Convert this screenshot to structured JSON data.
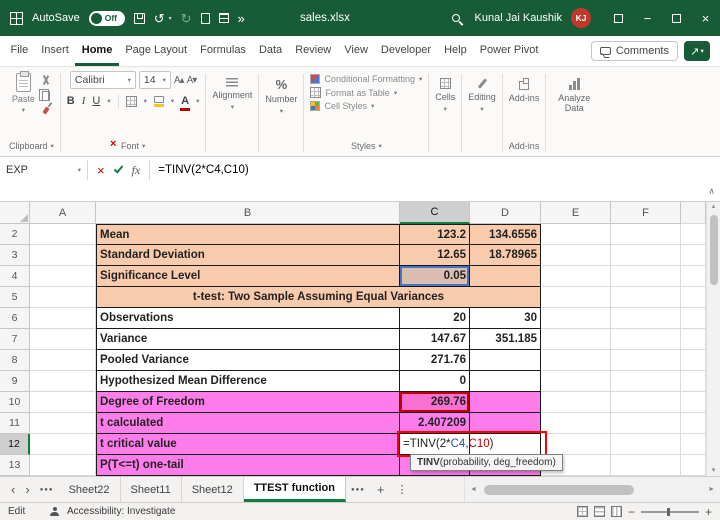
{
  "colors": {
    "titlebar_green": "#185C37",
    "accent_green": "#107C41",
    "orange_fill": "#F8CBAD",
    "pink_fill": "#FF7DEB",
    "ref_blue": "#2B4BC8",
    "ref_red": "#C00000",
    "annotation_red": "#FF0000",
    "avatar_red": "#C0392B"
  },
  "title_bar": {
    "autosave_label": "AutoSave",
    "autosave_state": "Off",
    "filename": "sales.xlsx",
    "user_name": "Kunal Jai Kaushik",
    "user_initials": "KJ"
  },
  "menu": {
    "tabs": [
      "File",
      "Insert",
      "Home",
      "Page Layout",
      "Formulas",
      "Data",
      "Review",
      "View",
      "Developer",
      "Help",
      "Power Pivot"
    ],
    "active_tab": "Home",
    "comments_label": "Comments"
  },
  "ribbon": {
    "paste_label": "Paste",
    "font_name": "Calibri",
    "font_size": "14",
    "bold": "B",
    "italic": "I",
    "underline": "U",
    "groups": {
      "clipboard": "Clipboard",
      "font": "Font",
      "alignment": "Alignment",
      "number": "Number",
      "styles": "Styles",
      "cells": "Cells",
      "editing": "Editing",
      "addins": "Add-ins",
      "analyze": "Analyze Data"
    },
    "styles_items": [
      "Conditional Formatting",
      "Format as Table",
      "Cell Styles"
    ]
  },
  "formula_bar": {
    "name_box": "EXP",
    "fx": "fx",
    "formula": {
      "prefix": "=TINV(2*",
      "ref1": "C4",
      "sep": ",",
      "ref2": "C10",
      "suffix": ")"
    }
  },
  "grid": {
    "columns": [
      "A",
      "B",
      "C",
      "D",
      "E",
      "F"
    ],
    "selected_column": "C",
    "selected_row": "12",
    "rows": [
      {
        "num": "2",
        "label": "Mean",
        "c": "123.2",
        "d": "134.6556",
        "bg": "orange"
      },
      {
        "num": "3",
        "label": "Standard Deviation",
        "c": "12.65",
        "d": "18.78965",
        "bg": "orange"
      },
      {
        "num": "4",
        "label": "Significance Level",
        "c": "0.05",
        "d": "",
        "bg": "orange",
        "ref": "blue"
      },
      {
        "num": "5",
        "merged": "t-test: Two Sample Assuming Equal Variances",
        "bg": "orange"
      },
      {
        "num": "6",
        "label": "Observations",
        "c": "20",
        "d": "30",
        "bg": "plain"
      },
      {
        "num": "7",
        "label": "Variance",
        "c": "147.67",
        "d": "351.185",
        "bg": "plain"
      },
      {
        "num": "8",
        "label": "Pooled Variance",
        "c": "271.76",
        "d": "",
        "bg": "plain"
      },
      {
        "num": "9",
        "label": "Hypothesized Mean Difference",
        "c": "0",
        "d": "",
        "bg": "plain"
      },
      {
        "num": "10",
        "label": "Degree of Freedom",
        "c": "269.76",
        "d": "",
        "bg": "pink",
        "ref": "red"
      },
      {
        "num": "11",
        "label": "t calculated",
        "c": "2.407209",
        "d": "",
        "bg": "pink"
      },
      {
        "num": "12",
        "label": "t critical value",
        "c": "",
        "d": "",
        "bg": "pink",
        "formula": true
      },
      {
        "num": "13",
        "label": "P(T<=t) one-tail",
        "c": "",
        "d": "",
        "bg": "pink"
      }
    ]
  },
  "tooltip": {
    "bold": "TINV",
    "rest": "(probability, deg_freedom)"
  },
  "sheet_bar": {
    "tabs": [
      "Sheet22",
      "Sheet11",
      "Sheet12",
      "TTEST function"
    ],
    "active_tab": "TTEST function"
  },
  "status_bar": {
    "mode": "Edit",
    "accessibility": "Accessibility: Investigate"
  }
}
